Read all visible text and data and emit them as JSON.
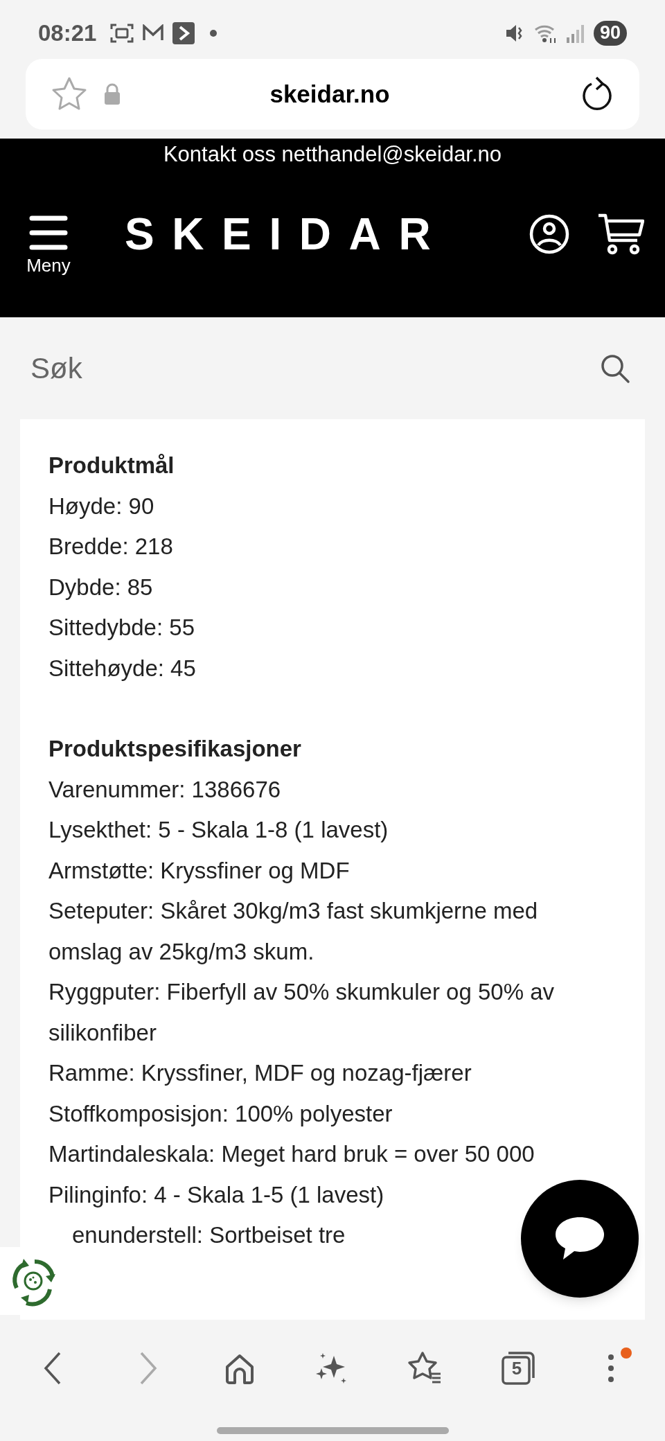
{
  "status_bar": {
    "time": "08:21",
    "battery": "90"
  },
  "browser": {
    "url": "skeidar.no"
  },
  "header": {
    "contact": "Kontakt oss netthandel@skeidar.no",
    "logo": "SKEIDAR",
    "menu_label": "Meny"
  },
  "search": {
    "placeholder": "Søk"
  },
  "sections": [
    {
      "title": "Produktmål",
      "lines": [
        {
          "text": "Høyde: 90",
          "kind": "line"
        },
        {
          "text": "Bredde: 218",
          "kind": "line"
        },
        {
          "text": "Dybde: 85",
          "kind": "line"
        },
        {
          "text": "Sittedybde: 55",
          "kind": "line"
        },
        {
          "text": "Sittehøyde: 45",
          "kind": "line"
        }
      ]
    },
    {
      "title": "Produktspesifikasjoner",
      "lines": [
        {
          "text": "Varenummer: 1386676",
          "kind": "line"
        },
        {
          "text": "Lysekthet: 5 - Skala 1-8 (1 lavest)",
          "kind": "line"
        },
        {
          "text": "Armstøtte: Kryssfiner og MDF",
          "kind": "line"
        },
        {
          "text": "Seteputer: Skåret 30kg/m3 fast skumkjerne med omslag av 25kg/m3 skum.",
          "kind": "line"
        },
        {
          "text": "Ryggputer: Fiberfyll av 50% skumkuler og 50% av silikonfiber",
          "kind": "line"
        },
        {
          "text": "Ramme: Kryssfiner, MDF og nozag-fjærer",
          "kind": "line"
        },
        {
          "text": "Stoffkomposisjon: 100% polyester",
          "kind": "line"
        },
        {
          "text": "Martindaleskala: Meget hard bruk = over 50 000",
          "kind": "line"
        },
        {
          "text": "Pilinginfo: 4 - Skala 1-5 (1 lavest)",
          "kind": "line"
        },
        {
          "text": "enunderstell: Sortbeiset tre",
          "kind": "covered"
        }
      ]
    }
  ],
  "nav": [
    {
      "kind": "back",
      "disabled": false
    },
    {
      "kind": "forward",
      "disabled": true
    },
    {
      "kind": "home",
      "disabled": false
    },
    {
      "kind": "sparkle",
      "disabled": false
    },
    {
      "kind": "bookmarks",
      "disabled": false
    },
    {
      "kind": "tabs",
      "disabled": false,
      "count": "5"
    },
    {
      "kind": "more",
      "disabled": false,
      "badge": true
    }
  ]
}
